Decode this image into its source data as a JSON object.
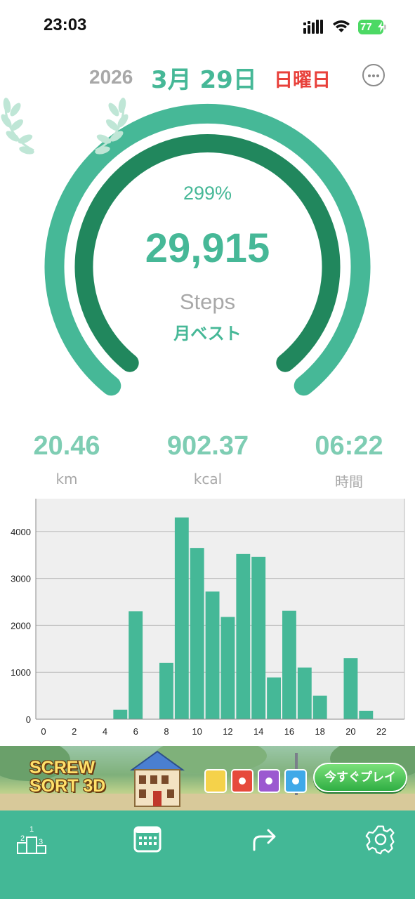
{
  "status_bar": {
    "time": "23:03",
    "battery": "77"
  },
  "header": {
    "year": "2026",
    "month_day": "3月 29日",
    "weekday": "日曜日"
  },
  "gauge": {
    "percent": "299%",
    "steps": "29,915",
    "unit": "Steps",
    "badge": "月ベスト",
    "progress_fraction": 1.0
  },
  "stats": [
    {
      "value": "20.46",
      "unit": "km"
    },
    {
      "value": "902.37",
      "unit": "kcal"
    },
    {
      "value": "06:22",
      "unit": "時間"
    }
  ],
  "chart_data": {
    "type": "bar",
    "x_ticks": [
      "0",
      "2",
      "4",
      "6",
      "8",
      "10",
      "12",
      "14",
      "16",
      "18",
      "20",
      "22"
    ],
    "y_ticks": [
      "0",
      "1000",
      "2000",
      "3000",
      "4000"
    ],
    "ylim": [
      0,
      4700
    ],
    "xlim": [
      -0.5,
      23.5
    ],
    "hours": [
      0,
      1,
      2,
      3,
      4,
      5,
      6,
      7,
      8,
      9,
      10,
      11,
      12,
      13,
      14,
      15,
      16,
      17,
      18,
      19,
      20,
      21,
      22,
      23
    ],
    "values": [
      0,
      0,
      0,
      0,
      0,
      200,
      2300,
      0,
      1200,
      4300,
      3650,
      2720,
      2180,
      3520,
      3460,
      890,
      2310,
      1100,
      500,
      0,
      1300,
      180,
      0,
      0
    ],
    "bar_color": "#45b897",
    "grid": true
  },
  "ad": {
    "title_line1": "SCREW",
    "title_line2": "SORT 3D",
    "cta": "今すぐプレイ"
  },
  "tab_bar": {
    "items": [
      {
        "icon": "ranking-podium-icon"
      },
      {
        "icon": "calendar-icon"
      },
      {
        "icon": "share-icon"
      },
      {
        "icon": "settings-gear-icon"
      }
    ]
  },
  "colors": {
    "accent": "#46b897",
    "dark_accent": "#21875d",
    "weekday": "#e8413b",
    "tab_bar": "#43b896"
  }
}
